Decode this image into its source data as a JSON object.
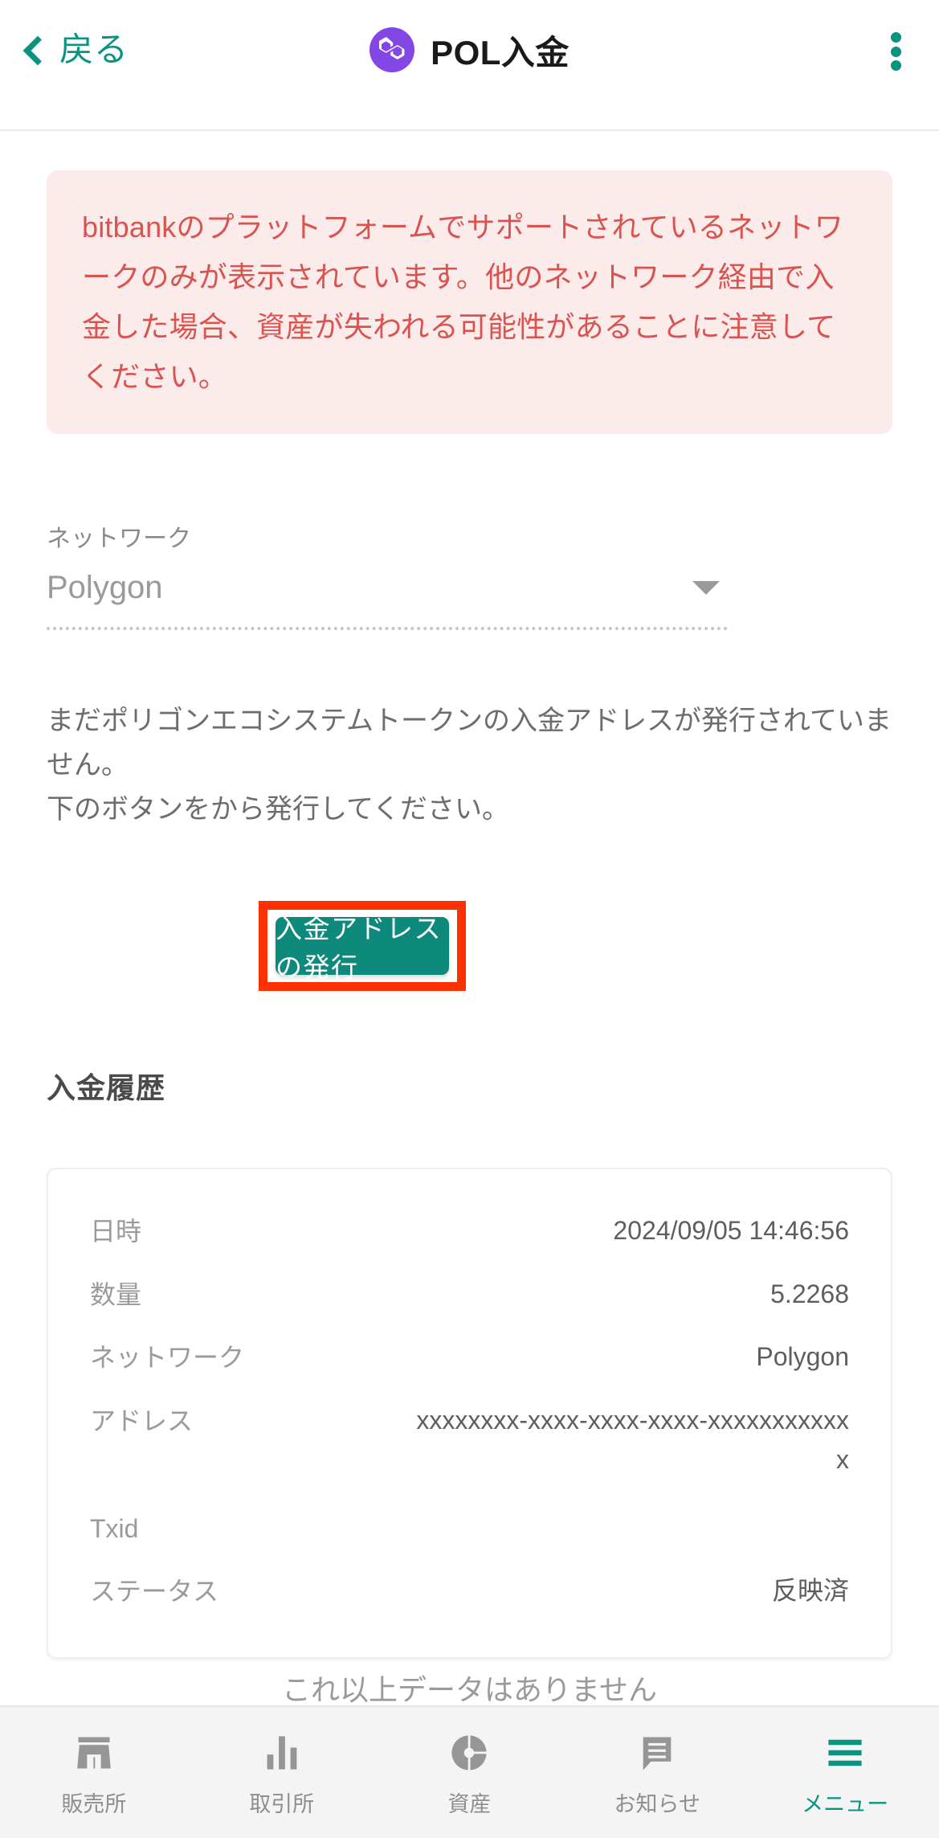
{
  "header": {
    "back_label": "戻る",
    "title": "POL入金",
    "coin_icon": "polygon-icon",
    "menu_icon": "kebab-menu-icon",
    "back_icon": "chevron-left-icon"
  },
  "warning": {
    "text": "bitbankのプラットフォームでサポートされているネットワークのみが表示されています。他のネットワーク経由で入金した場合、資産が失われる可能性があることに注意してください。",
    "bg_color": "#fbeceb",
    "text_color": "#d9534f"
  },
  "network": {
    "label": "ネットワーク",
    "value": "Polygon",
    "caret_icon": "chevron-down-icon"
  },
  "body": {
    "text": "まだポリゴンエコシステムトークンの入金アドレスが発行されていません。\n下のボタンをから発行してください。"
  },
  "cta": {
    "label": "入金アドレスの発行",
    "color": "#0e8a7d",
    "highlight_color": "#fc3000"
  },
  "history": {
    "title": "入金履歴",
    "rows": [
      {
        "key": "日時",
        "value": "2024/09/05 14:46:56"
      },
      {
        "key": "数量",
        "value": "5.2268"
      },
      {
        "key": "ネットワーク",
        "value": "Polygon"
      },
      {
        "key": "アドレス",
        "value": "xxxxxxxx-xxxx-xxxx-xxxx-xxxxxxxxxxxx"
      },
      {
        "key": "Txid",
        "value": ""
      },
      {
        "key": "ステータス",
        "value": "反映済"
      }
    ],
    "empty_text": "これ以上データはありません"
  },
  "bottom_nav": {
    "items": [
      {
        "label": "販売所",
        "icon": "store-icon",
        "active": false
      },
      {
        "label": "取引所",
        "icon": "bar-chart-icon",
        "active": false
      },
      {
        "label": "資産",
        "icon": "pie-chart-icon",
        "active": false
      },
      {
        "label": "お知らせ",
        "icon": "speech-bubble-icon",
        "active": false
      },
      {
        "label": "メニュー",
        "icon": "hamburger-menu-icon",
        "active": true
      }
    ],
    "active_color": "#0b9382",
    "inactive_color": "#8e8e8e"
  }
}
